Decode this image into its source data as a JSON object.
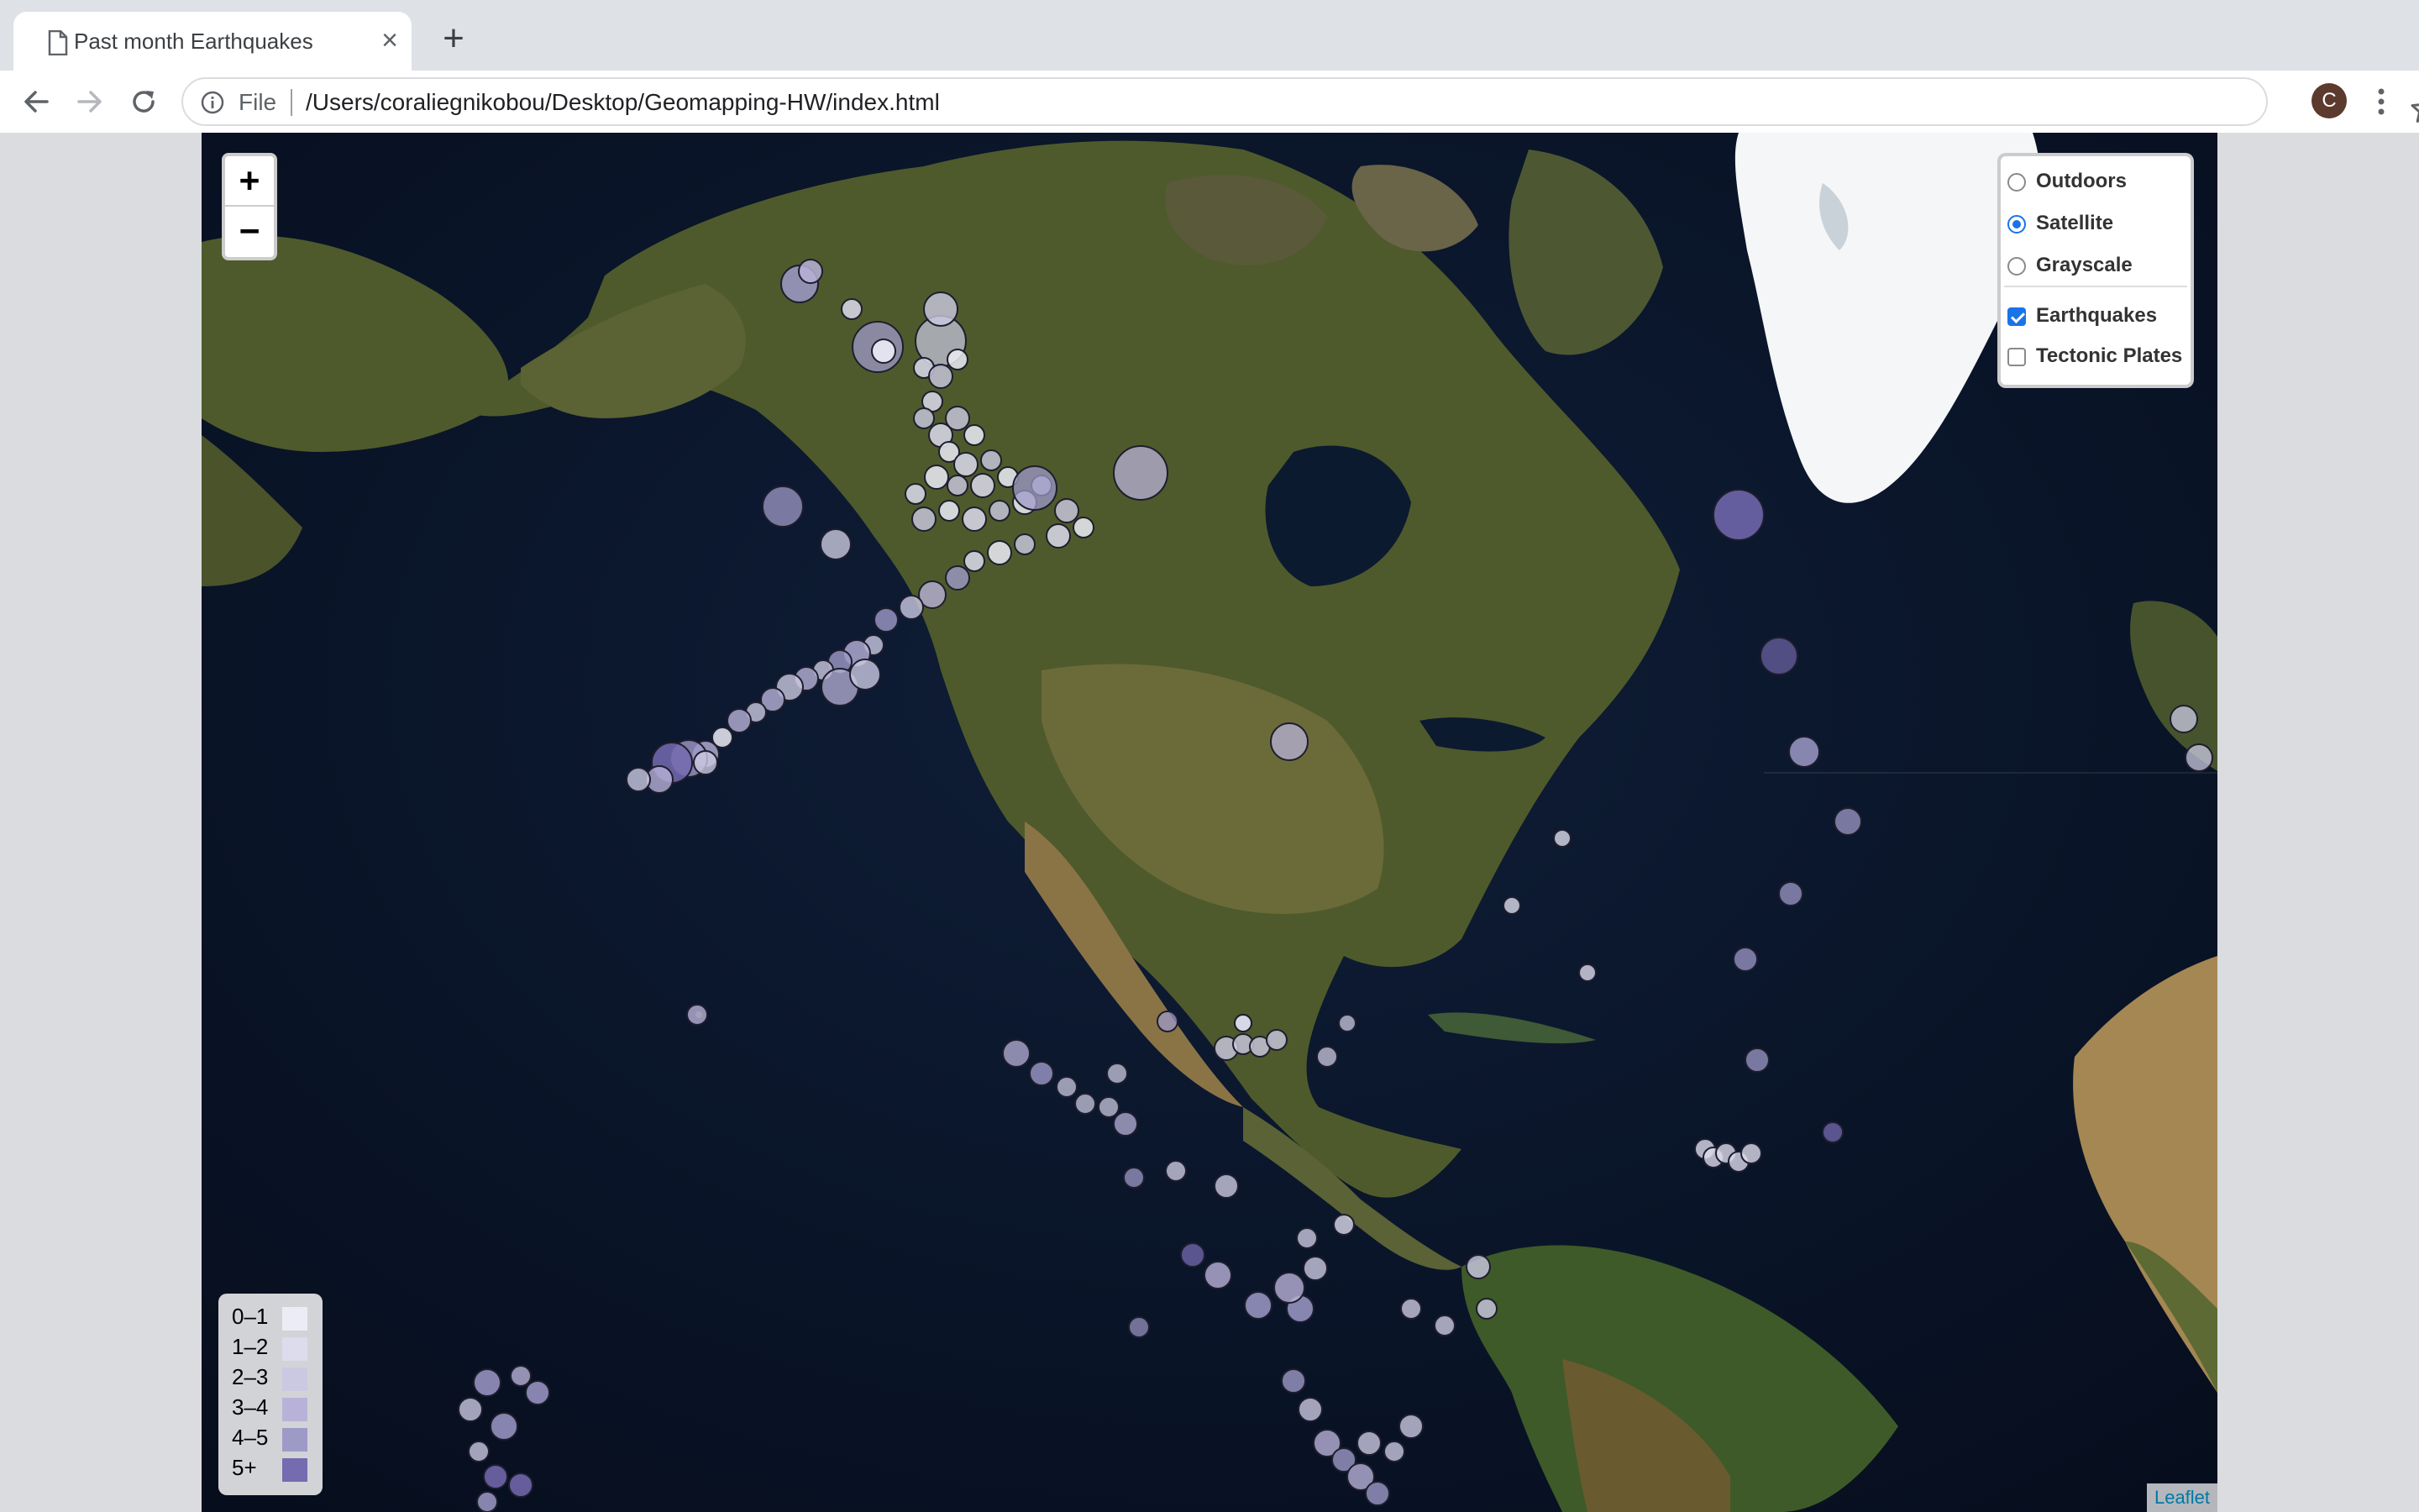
{
  "browser": {
    "tab": {
      "title": "Past month Earthquakes",
      "close_glyph": "×"
    },
    "new_tab_glyph": "+",
    "omnibox": {
      "scheme_label": "File",
      "url": "/Users/coraliegnikobou/Desktop/Geomapping-HW/index.html"
    },
    "profile_initial": "C"
  },
  "map": {
    "zoom_in": "+",
    "zoom_out": "−",
    "base_layers": [
      {
        "label": "Outdoors",
        "selected": false
      },
      {
        "label": "Satellite",
        "selected": true
      },
      {
        "label": "Grayscale",
        "selected": false
      }
    ],
    "overlays": [
      {
        "label": "Earthquakes",
        "checked": true
      },
      {
        "label": "Tectonic Plates",
        "checked": false
      }
    ],
    "legend": [
      {
        "label": "0–1",
        "color": "#ececf6"
      },
      {
        "label": "1–2",
        "color": "#dcdcec"
      },
      {
        "label": "2–3",
        "color": "#cbc9e2"
      },
      {
        "label": "3–4",
        "color": "#b8b2d8"
      },
      {
        "label": "4–5",
        "color": "#9e9ac8"
      },
      {
        "label": "5+",
        "color": "#756bb1"
      }
    ],
    "attribution": "Leaflet"
  },
  "colors": {
    "accent": "#1a73e8",
    "ocean": "#0a1527",
    "earthquake_stroke": "#1e1e2e"
  },
  "icons": [
    "page-icon",
    "close-icon",
    "plus-icon",
    "back-arrow-icon",
    "forward-arrow-icon",
    "reload-icon",
    "info-icon",
    "star-icon",
    "kebab-menu-icon"
  ]
}
